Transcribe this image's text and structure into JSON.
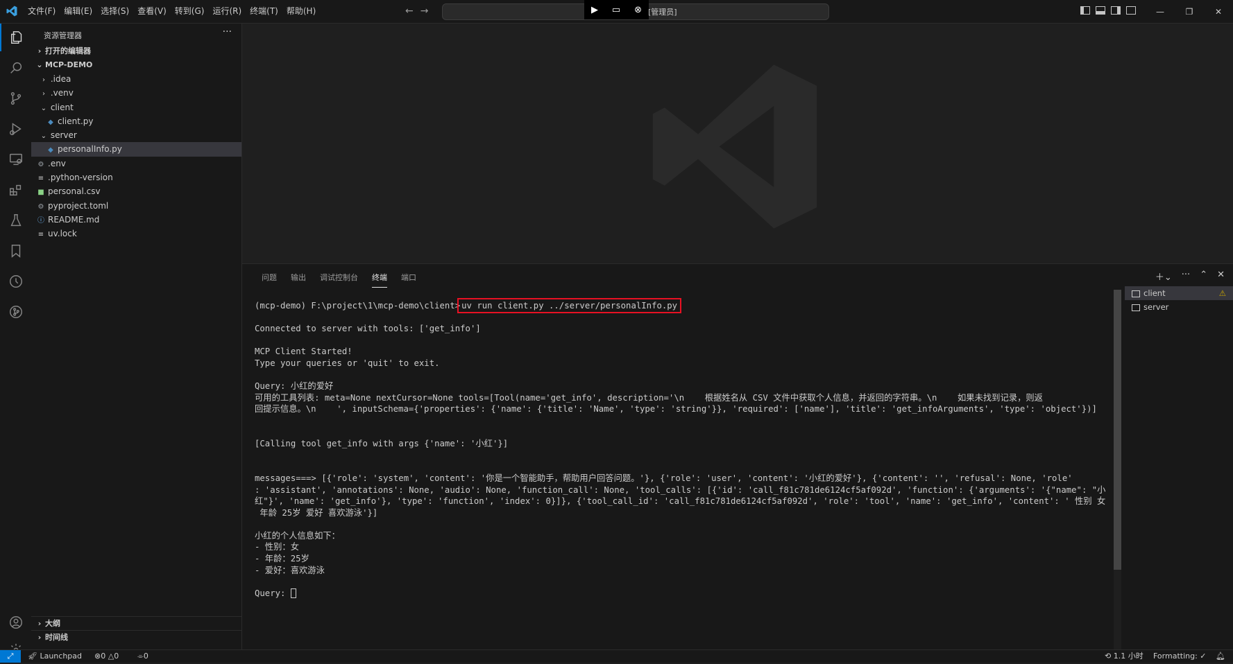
{
  "menu": [
    "文件(F)",
    "编辑(E)",
    "选择(S)",
    "查看(V)",
    "转到(G)",
    "运行(R)",
    "终端(T)",
    "帮助(H)"
  ],
  "command_center": {
    "text": "[管理员]"
  },
  "explorer": {
    "title": "资源管理器",
    "more": "···",
    "open_editors": "打开的编辑器",
    "project": "MCP-DEMO",
    "outline": "大纲",
    "timeline": "时间线",
    "tree": [
      {
        "label": ".idea",
        "type": "folder",
        "depth": 1,
        "open": false
      },
      {
        "label": ".venv",
        "type": "folder",
        "depth": 1,
        "open": false
      },
      {
        "label": "client",
        "type": "folder",
        "depth": 1,
        "open": true
      },
      {
        "label": "client.py",
        "type": "python",
        "depth": 2
      },
      {
        "label": "server",
        "type": "folder",
        "depth": 1,
        "open": true
      },
      {
        "label": "personalInfo.py",
        "type": "python",
        "depth": 2,
        "selected": true
      },
      {
        "label": ".env",
        "type": "gear",
        "depth": 1
      },
      {
        "label": ".python-version",
        "type": "lines",
        "depth": 1
      },
      {
        "label": "personal.csv",
        "type": "csv",
        "depth": 1
      },
      {
        "label": "pyproject.toml",
        "type": "gear",
        "depth": 1
      },
      {
        "label": "README.md",
        "type": "info",
        "depth": 1
      },
      {
        "label": "uv.lock",
        "type": "lines",
        "depth": 1
      }
    ]
  },
  "panel": {
    "tabs": [
      "问题",
      "输出",
      "调试控制台",
      "终端",
      "端口"
    ],
    "active_tab": "终端"
  },
  "terminal": {
    "prompt": "(mcp-demo) F:\\project\\1\\mcp-demo\\client>",
    "command": "uv run client.py ../server/personalInfo.py",
    "lines": [
      "Connected to server with tools: ['get_info']",
      "",
      "MCP Client Started!",
      "Type your queries or 'quit' to exit.",
      "",
      "Query: 小红的爱好",
      "可用的工具列表: meta=None nextCursor=None tools=[Tool(name='get_info', description='\\n    根据姓名从 CSV 文件中获取个人信息，并返回的字符串。\\n    如果未找到记录，则返",
      "回提示信息。\\n    ', inputSchema={'properties': {'name': {'title': 'Name', 'type': 'string'}}, 'required': ['name'], 'title': 'get_infoArguments', 'type': 'object'})]",
      "",
      "",
      "[Calling tool get_info with args {'name': '小红'}]",
      "",
      "",
      "messages===> [{'role': 'system', 'content': '你是一个智能助手，帮助用户回答问题。'}, {'role': 'user', 'content': '小红的爱好'}, {'content': '', 'refusal': None, 'role'",
      ": 'assistant', 'annotations': None, 'audio': None, 'function_call': None, 'tool_calls': [{'id': 'call_f81c781de6124cf5af092d', 'function': {'arguments': '{\"name\": \"小",
      "红\"}', 'name': 'get_info'}, 'type': 'function', 'index': 0}]}, {'tool_call_id': 'call_f81c781de6124cf5af092d', 'role': 'tool', 'name': 'get_info', 'content': ' 性别 女",
      " 年龄 25岁 爱好 喜欢游泳'}]",
      "",
      "小红的个人信息如下：",
      "- 性别：女",
      "- 年龄：25岁",
      "- 爱好：喜欢游泳",
      ""
    ],
    "final_prompt": "Query: ",
    "instances": [
      {
        "name": "client",
        "active": true,
        "warning": true
      },
      {
        "name": "server",
        "active": false,
        "warning": false
      }
    ]
  },
  "status": {
    "launchpad": "Launchpad",
    "errors": "0",
    "warnings": "0",
    "ports": "0",
    "time": "1.1 小时",
    "formatting": "Formatting: ✓"
  }
}
